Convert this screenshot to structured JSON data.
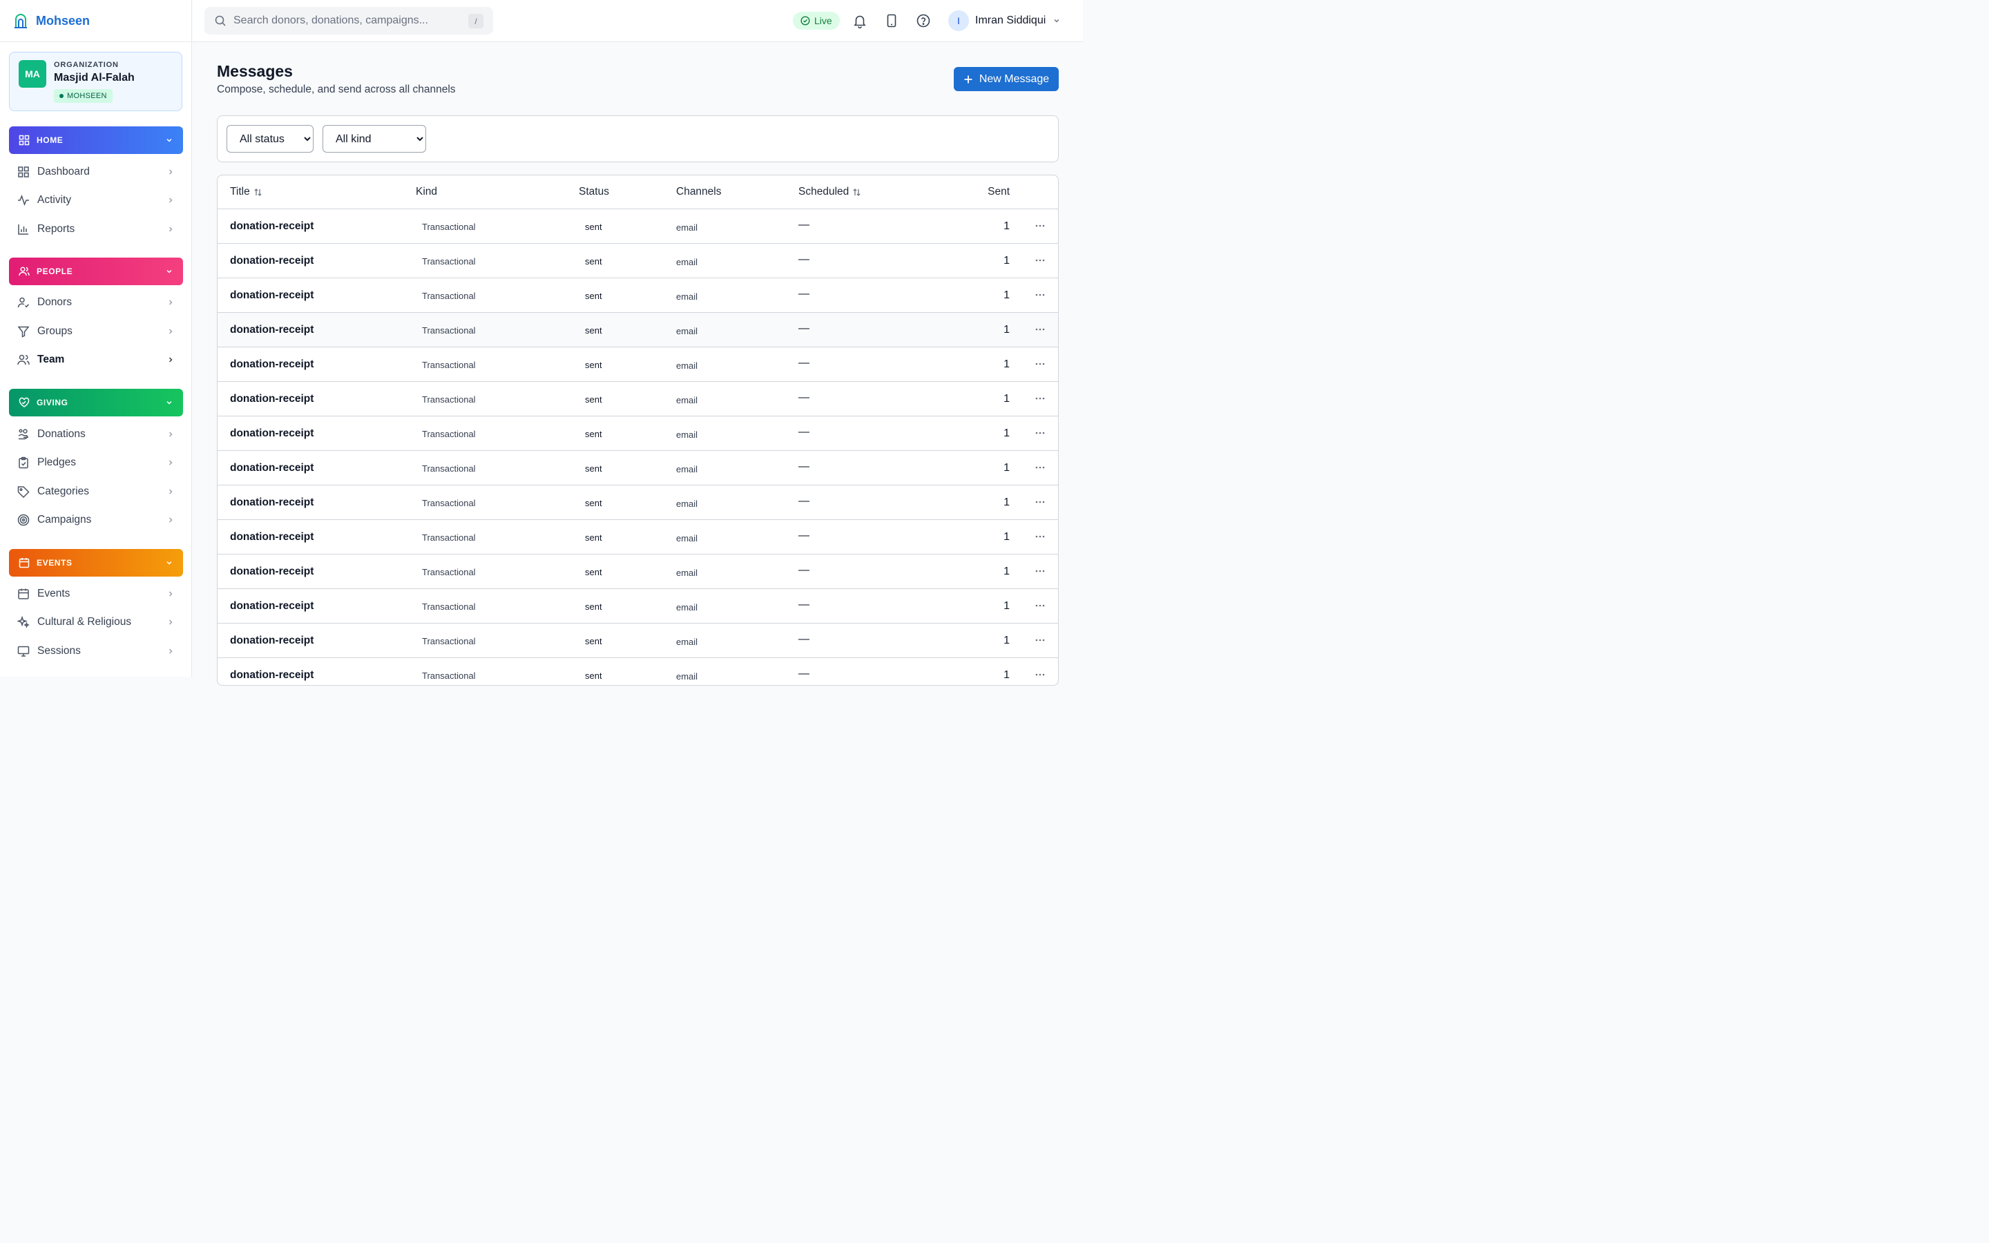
{
  "brand": {
    "name": "Mohseen"
  },
  "organization": {
    "initials": "MA",
    "label": "ORGANIZATION",
    "name": "Masjid Al-Falah",
    "badge": "MOHSEEN"
  },
  "sidebar": {
    "sections": [
      {
        "label": "HOME",
        "items": [
          {
            "label": "Dashboard"
          },
          {
            "label": "Activity"
          },
          {
            "label": "Reports"
          }
        ]
      },
      {
        "label": "PEOPLE",
        "items": [
          {
            "label": "Donors"
          },
          {
            "label": "Groups"
          },
          {
            "label": "Team"
          }
        ]
      },
      {
        "label": "GIVING",
        "items": [
          {
            "label": "Donations"
          },
          {
            "label": "Pledges"
          },
          {
            "label": "Categories"
          },
          {
            "label": "Campaigns"
          }
        ]
      },
      {
        "label": "EVENTS",
        "items": [
          {
            "label": "Events"
          },
          {
            "label": "Cultural & Religious"
          },
          {
            "label": "Sessions"
          }
        ]
      }
    ]
  },
  "topbar": {
    "search_placeholder": "Search donors, donations, campaigns...",
    "search_shortcut": "/",
    "live_label": "Live",
    "user": {
      "initial": "I",
      "name": "Imran Siddiqui"
    }
  },
  "page": {
    "title": "Messages",
    "subtitle": "Compose, schedule, and send across all channels",
    "new_button": "New Message"
  },
  "filters": {
    "status": {
      "selected": "All status"
    },
    "kind": {
      "selected": "All kind"
    }
  },
  "table": {
    "columns": {
      "title": "Title",
      "kind": "Kind",
      "status": "Status",
      "channels": "Channels",
      "scheduled": "Scheduled",
      "sent": "Sent"
    },
    "rows": [
      {
        "title": "donation-receipt",
        "kind": "Transactional",
        "status": "sent",
        "channels": "email",
        "scheduled": "—",
        "sent": "1"
      },
      {
        "title": "donation-receipt",
        "kind": "Transactional",
        "status": "sent",
        "channels": "email",
        "scheduled": "—",
        "sent": "1"
      },
      {
        "title": "donation-receipt",
        "kind": "Transactional",
        "status": "sent",
        "channels": "email",
        "scheduled": "—",
        "sent": "1"
      },
      {
        "title": "donation-receipt",
        "kind": "Transactional",
        "status": "sent",
        "channels": "email",
        "scheduled": "—",
        "sent": "1"
      },
      {
        "title": "donation-receipt",
        "kind": "Transactional",
        "status": "sent",
        "channels": "email",
        "scheduled": "—",
        "sent": "1"
      },
      {
        "title": "donation-receipt",
        "kind": "Transactional",
        "status": "sent",
        "channels": "email",
        "scheduled": "—",
        "sent": "1"
      },
      {
        "title": "donation-receipt",
        "kind": "Transactional",
        "status": "sent",
        "channels": "email",
        "scheduled": "—",
        "sent": "1"
      },
      {
        "title": "donation-receipt",
        "kind": "Transactional",
        "status": "sent",
        "channels": "email",
        "scheduled": "—",
        "sent": "1"
      },
      {
        "title": "donation-receipt",
        "kind": "Transactional",
        "status": "sent",
        "channels": "email",
        "scheduled": "—",
        "sent": "1"
      },
      {
        "title": "donation-receipt",
        "kind": "Transactional",
        "status": "sent",
        "channels": "email",
        "scheduled": "—",
        "sent": "1"
      },
      {
        "title": "donation-receipt",
        "kind": "Transactional",
        "status": "sent",
        "channels": "email",
        "scheduled": "—",
        "sent": "1"
      },
      {
        "title": "donation-receipt",
        "kind": "Transactional",
        "status": "sent",
        "channels": "email",
        "scheduled": "—",
        "sent": "1"
      },
      {
        "title": "donation-receipt",
        "kind": "Transactional",
        "status": "sent",
        "channels": "email",
        "scheduled": "—",
        "sent": "1"
      },
      {
        "title": "donation-receipt",
        "kind": "Transactional",
        "status": "sent",
        "channels": "email",
        "scheduled": "—",
        "sent": "1"
      }
    ]
  },
  "colors": {
    "accent": "#1d6fd1",
    "home": "#4f46e5",
    "people": "#e11d74",
    "giving": "#059669",
    "events": "#ea580c"
  }
}
